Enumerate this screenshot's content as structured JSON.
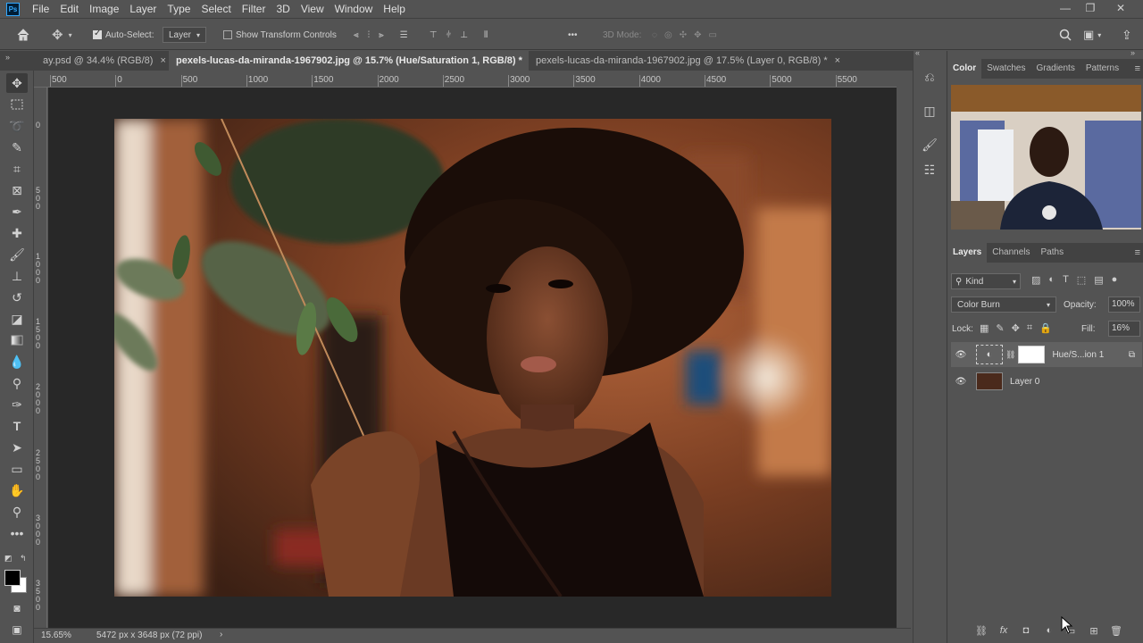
{
  "app": {
    "logo": "Ps"
  },
  "menu": [
    "File",
    "Edit",
    "Image",
    "Layer",
    "Type",
    "Select",
    "Filter",
    "3D",
    "View",
    "Window",
    "Help"
  ],
  "window_controls": {
    "minimize": "—",
    "restore": "❐",
    "close": "✕"
  },
  "options": {
    "auto_select_label": "Auto-Select:",
    "auto_select_checked": true,
    "target_value": "Layer",
    "show_transform_label": "Show Transform Controls",
    "show_transform_checked": false,
    "more": "•••",
    "mode_3d_label": "3D Mode:"
  },
  "tabs": [
    {
      "label": "ay.psd @ 34.4% (RGB/8)",
      "close": "×",
      "active": false
    },
    {
      "label": "pexels-lucas-da-miranda-1967902.jpg @ 15.7% (Hue/Saturation 1, RGB/8) *",
      "close": "×",
      "active": true
    },
    {
      "label": "pexels-lucas-da-miranda-1967902.jpg @ 17.5% (Layer 0, RGB/8) *",
      "close": "×",
      "active": false
    }
  ],
  "ruler": {
    "h_labels": [
      "500",
      "0",
      "500",
      "1000",
      "1500",
      "2000",
      "2500",
      "3000",
      "3500",
      "4000",
      "4500",
      "5000",
      "5500"
    ],
    "v_labels": [
      "0",
      "500",
      "1000",
      "1500",
      "2000",
      "2500",
      "3000",
      "3500"
    ]
  },
  "status": {
    "zoom": "15.65%",
    "doc_size": "5472 px x 3648 px (72 ppi)",
    "arrow": "›"
  },
  "color_panel": {
    "tabs": [
      "Color",
      "Swatches",
      "Gradients",
      "Patterns"
    ],
    "active_tab": "Color"
  },
  "layers_panel": {
    "tabs": [
      "Layers",
      "Channels",
      "Paths"
    ],
    "active_tab": "Layers",
    "filter_kind": "Kind",
    "blend_mode": "Color Burn",
    "opacity_label": "Opacity:",
    "opacity_value": "100%",
    "lock_label": "Lock:",
    "fill_label": "Fill:",
    "fill_value": "16%",
    "layers": [
      {
        "name": "Hue/S...ion 1",
        "type": "adjustment",
        "visible": true,
        "selected": true
      },
      {
        "name": "Layer 0",
        "type": "pixel",
        "visible": true,
        "selected": false
      }
    ]
  },
  "colors": {
    "ui_bg": "#535353",
    "dark_bg": "#424242",
    "canvas_bg": "#282828",
    "ps_blue": "#31a8ff",
    "ps_navy": "#001e36"
  }
}
